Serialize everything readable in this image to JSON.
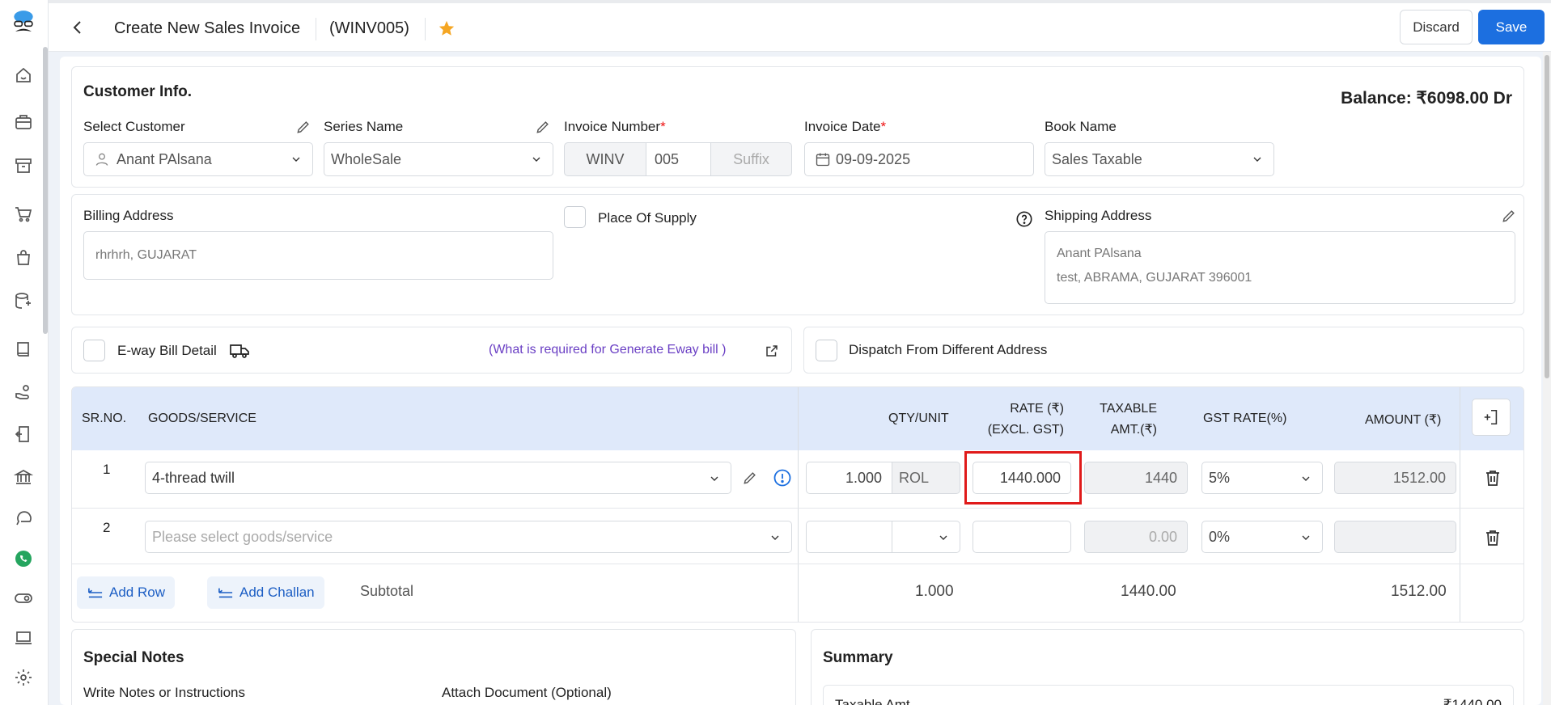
{
  "header": {
    "title": "Create New Sales Invoice",
    "code": "(WINV005)",
    "discard_label": "Discard",
    "save_label": "Save"
  },
  "customer_info": {
    "title": "Customer Info.",
    "balance": "Balance: ₹6098.00 Dr",
    "select_customer_label": "Select Customer",
    "customer_value": "Anant PAlsana",
    "series_label": "Series Name",
    "series_value": "WholeSale",
    "invoice_number_label": "Invoice Number",
    "invoice_prefix": "WINV",
    "invoice_number": "005",
    "invoice_suffix_placeholder": "Suffix",
    "invoice_date_label": "Invoice Date",
    "invoice_date": "09-09-2025",
    "book_label": "Book Name",
    "book_value": "Sales Taxable"
  },
  "address": {
    "billing_label": "Billing Address",
    "billing_value": "rhrhrh, GUJARAT",
    "place_of_supply_label": "Place Of Supply",
    "shipping_label": "Shipping Address",
    "shipping_line1": "Anant PAlsana",
    "shipping_line2": "test, ABRAMA, GUJARAT 396001"
  },
  "eway": {
    "label": "E-way Bill Detail",
    "link": "(What is required for Generate Eway bill )",
    "dispatch_label": "Dispatch From Different Address"
  },
  "table": {
    "headers": {
      "sr": "SR.NO.",
      "goods": "GOODS/SERVICE",
      "qty": "QTY/UNIT",
      "rate_line1": "RATE (₹)",
      "rate_line2": "(EXCL. GST)",
      "taxable_line1": "TAXABLE",
      "taxable_line2": "AMT.(₹)",
      "gst": "GST RATE(%)",
      "amount": "AMOUNT (₹)"
    },
    "rows": [
      {
        "sr": "1",
        "goods": "4-thread twill",
        "qty": "1.000",
        "unit": "ROL",
        "rate": "1440.000",
        "taxable": "1440",
        "gst": "5%",
        "amount": "1512.00"
      },
      {
        "sr": "2",
        "goods_placeholder": "Please select goods/service",
        "qty": "",
        "unit": "",
        "rate": "",
        "taxable": "0.00",
        "gst": "0%",
        "amount": ""
      }
    ],
    "add_row": "Add Row",
    "add_challan": "Add Challan",
    "subtotal_label": "Subtotal",
    "subtotal_qty": "1.000",
    "subtotal_taxable": "1440.00",
    "subtotal_amount": "1512.00"
  },
  "notes": {
    "title": "Special Notes",
    "write_label": "Write Notes or Instructions",
    "attach_label": "Attach Document (Optional)"
  },
  "summary": {
    "title": "Summary",
    "taxable_label": "Taxable Amt",
    "taxable_value": "₹1440.00"
  },
  "colors": {
    "accent": "#1c6fe0",
    "table_header": "#dfe9fa",
    "link": "#6a3fc4",
    "highlight": "#e01a1a",
    "star": "#f5a623"
  }
}
